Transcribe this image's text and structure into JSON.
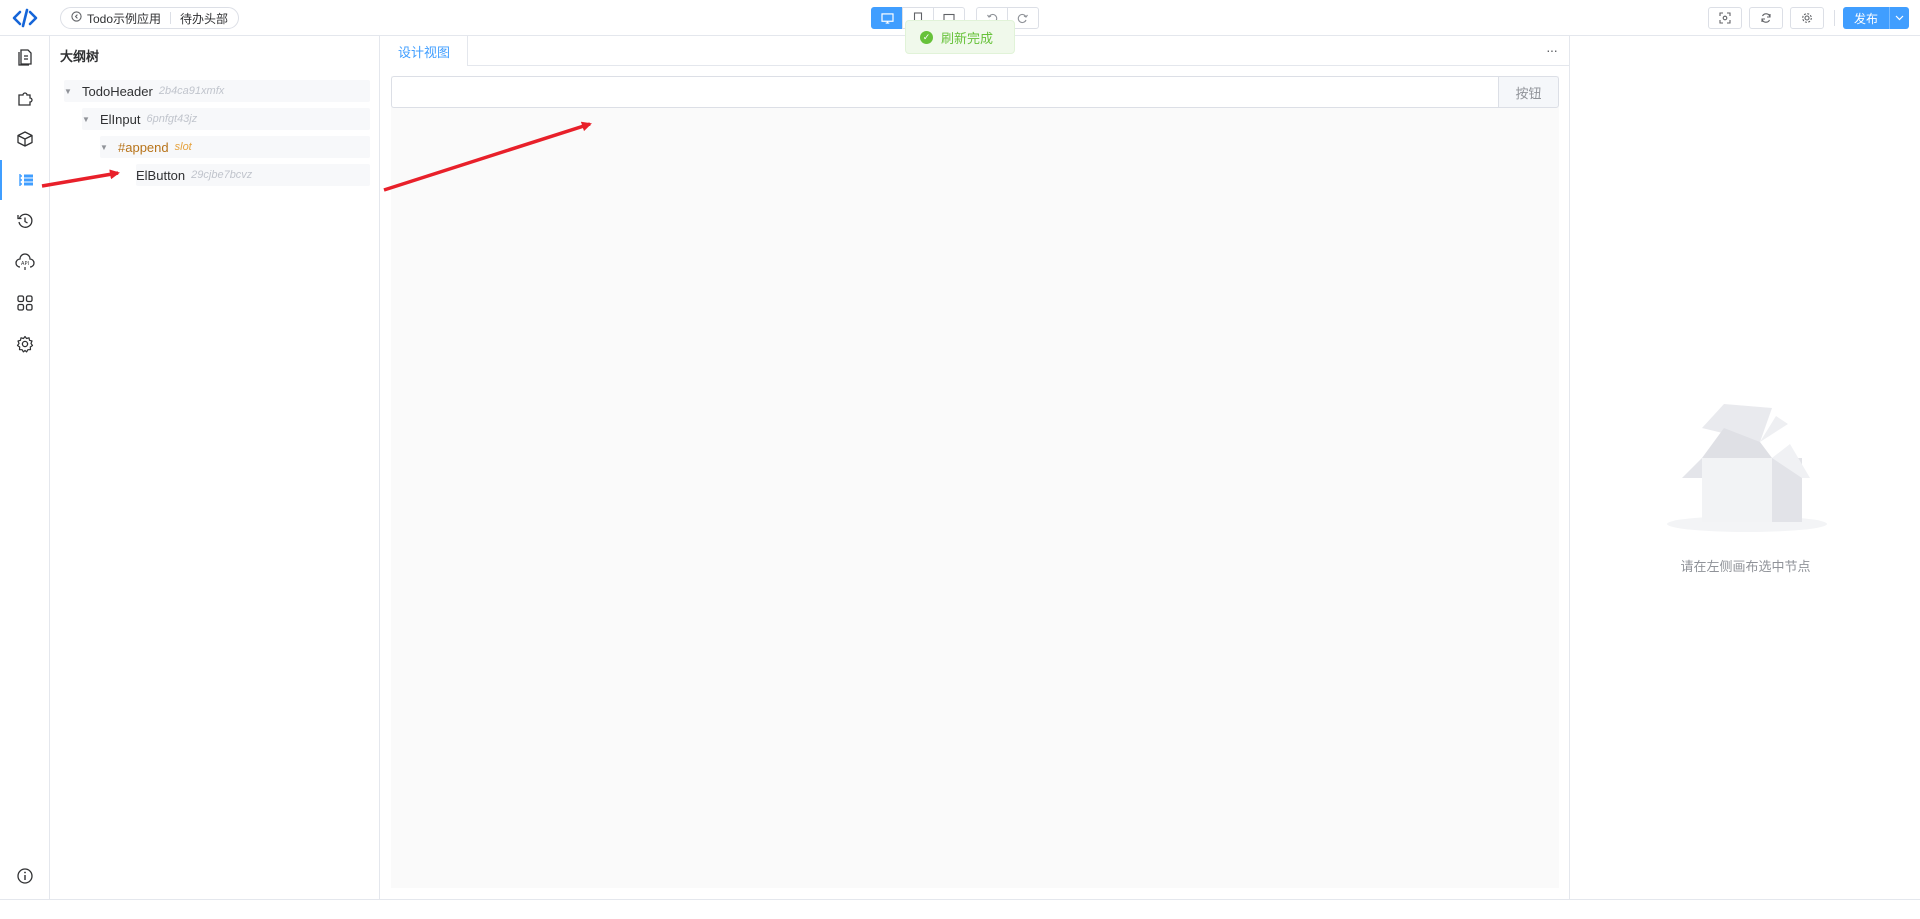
{
  "header": {
    "project_name": "Todo示例应用",
    "page_name": "待办头部",
    "publish_label": "发布",
    "toast_message": "刷新完成"
  },
  "rail": {
    "items": [
      "pages-icon",
      "components-icon",
      "blocks-icon",
      "outline-icon",
      "history-icon",
      "api-icon",
      "apps-icon",
      "settings-icon"
    ],
    "active": "outline-icon"
  },
  "outline": {
    "title": "大纲树",
    "nodes": [
      {
        "name": "TodoHeader",
        "id": "2b4ca91xmfx"
      },
      {
        "name": "ElInput",
        "id": "6pnfgt43jz"
      },
      {
        "name": "#append",
        "id": "slot"
      },
      {
        "name": "ElButton",
        "id": "29cjbe7bcvz"
      }
    ]
  },
  "canvas": {
    "tab_label": "设计视图",
    "more_label": "···",
    "button_label": "按钮"
  },
  "props": {
    "empty_text": "请在左侧画布选中节点"
  },
  "colors": {
    "accent": "#409eff",
    "success": "#67c23a",
    "annotation": "#e8202a"
  }
}
